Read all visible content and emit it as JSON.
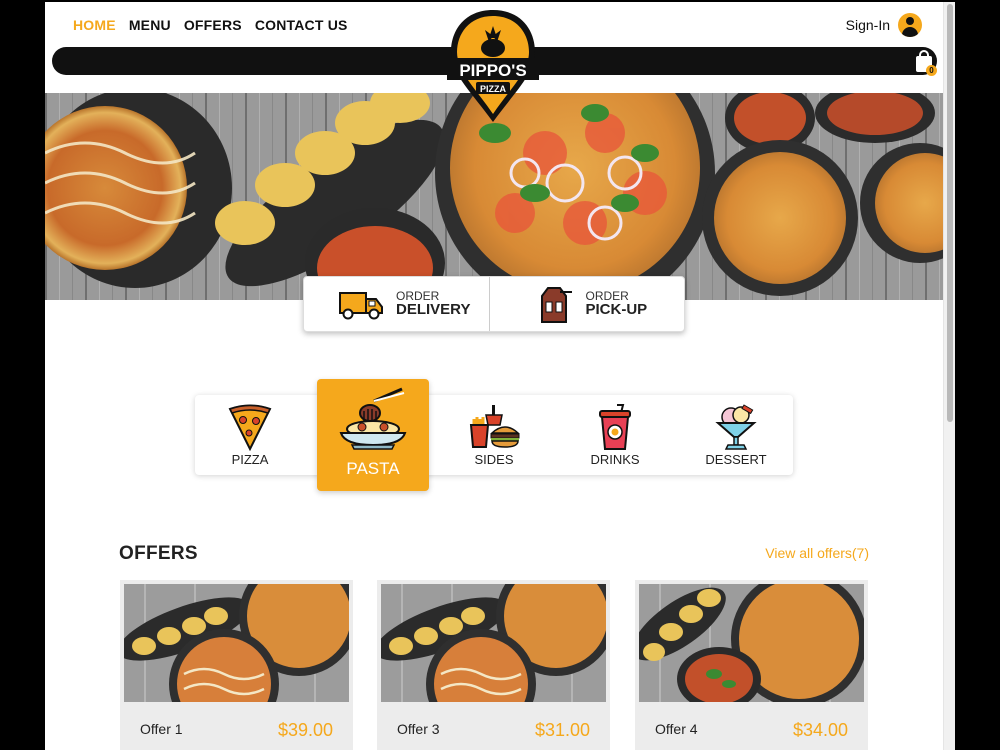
{
  "nav": {
    "items": [
      {
        "label": "HOME",
        "active": true
      },
      {
        "label": "MENU",
        "active": false
      },
      {
        "label": "OFFERS",
        "active": false
      },
      {
        "label": "CONTACT US",
        "active": false
      }
    ]
  },
  "account": {
    "signin_label": "Sign-In"
  },
  "cart": {
    "count": "0"
  },
  "logo": {
    "name": "PIPPO'S",
    "sub": "PIZZA"
  },
  "order": {
    "delivery": {
      "small": "ORDER",
      "big": "DELIVERY",
      "icon": "delivery-truck-icon"
    },
    "pickup": {
      "small": "ORDER",
      "big": "PICK-UP",
      "icon": "takeaway-bag-icon"
    }
  },
  "categories": [
    {
      "label": "PIZZA",
      "icon": "pizza-slice-icon",
      "active": false
    },
    {
      "label": "PASTA",
      "icon": "pasta-bowl-icon",
      "active": true
    },
    {
      "label": "SIDES",
      "icon": "fries-burger-icon",
      "active": false
    },
    {
      "label": "DRINKS",
      "icon": "drink-cup-icon",
      "active": false
    },
    {
      "label": "DESSERT",
      "icon": "ice-cream-icon",
      "active": false
    }
  ],
  "offers": {
    "title": "OFFERS",
    "view_all": "View all offers(7)",
    "cards": [
      {
        "name": "Offer 1",
        "price": "$39.00"
      },
      {
        "name": "Offer 3",
        "price": "$31.00"
      },
      {
        "name": "Offer 4",
        "price": "$34.00"
      }
    ]
  },
  "colors": {
    "accent": "#f5a81c",
    "dark": "#111111"
  }
}
